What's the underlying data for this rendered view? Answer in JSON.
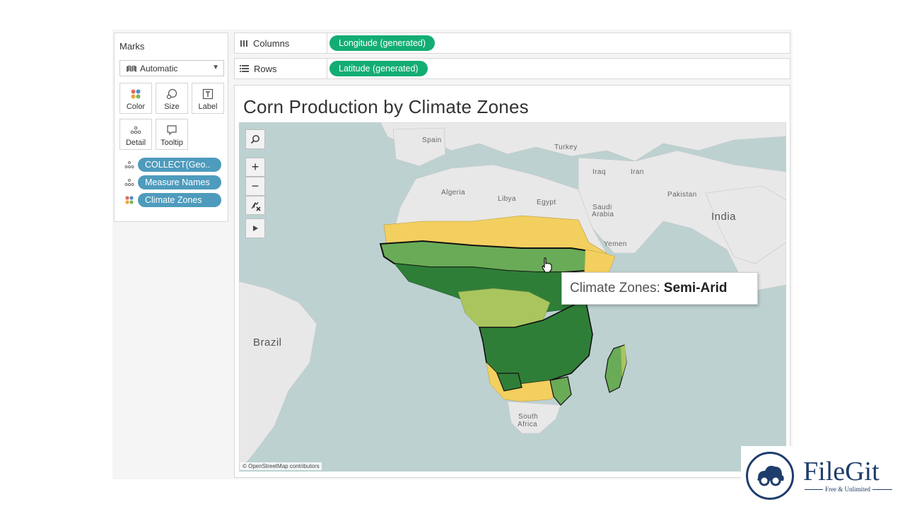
{
  "marks": {
    "title": "Marks",
    "mark_type": "Automatic",
    "buttons": {
      "color": "Color",
      "size": "Size",
      "label": "Label",
      "detail": "Detail",
      "tooltip": "Tooltip"
    },
    "pills": [
      {
        "label": "COLLECT(Geo..",
        "icon": "detail-dots-icon"
      },
      {
        "label": "Measure Names",
        "icon": "detail-dots-icon"
      },
      {
        "label": "Climate Zones",
        "icon": "color-dots-icon"
      }
    ]
  },
  "shelves": {
    "columns": {
      "label": "Columns",
      "pill": "Longitude (generated)"
    },
    "rows": {
      "label": "Rows",
      "pill": "Latitude (generated)"
    }
  },
  "sheet": {
    "title": "Corn Production by Climate Zones",
    "attribution": "© OpenStreetMap contributors"
  },
  "map_labels": {
    "spain": "Spain",
    "turkey": "Turkey",
    "iraq": "Iraq",
    "iran": "Iran",
    "algeria": "Algeria",
    "libya": "Libya",
    "egypt": "Egypt",
    "saudi1": "Saudi",
    "saudi2": "Arabia",
    "pakistan": "Pakistan",
    "india": "India",
    "yemen": "Yemen",
    "brazil": "Brazil",
    "south1": "South",
    "south2": "Africa"
  },
  "tooltip": {
    "field": "Climate Zones:",
    "value": "Semi-Arid"
  },
  "watermark": {
    "brand": "FileGit",
    "tagline": "Free & Unlimited"
  },
  "colors": {
    "arid": "#f2cf5f",
    "semi_arid": "#6aab57",
    "humid": "#2f7e38",
    "subhumid": "#aac55e",
    "pill_blue": "#4e9bbd",
    "pill_green": "#13ad73"
  }
}
